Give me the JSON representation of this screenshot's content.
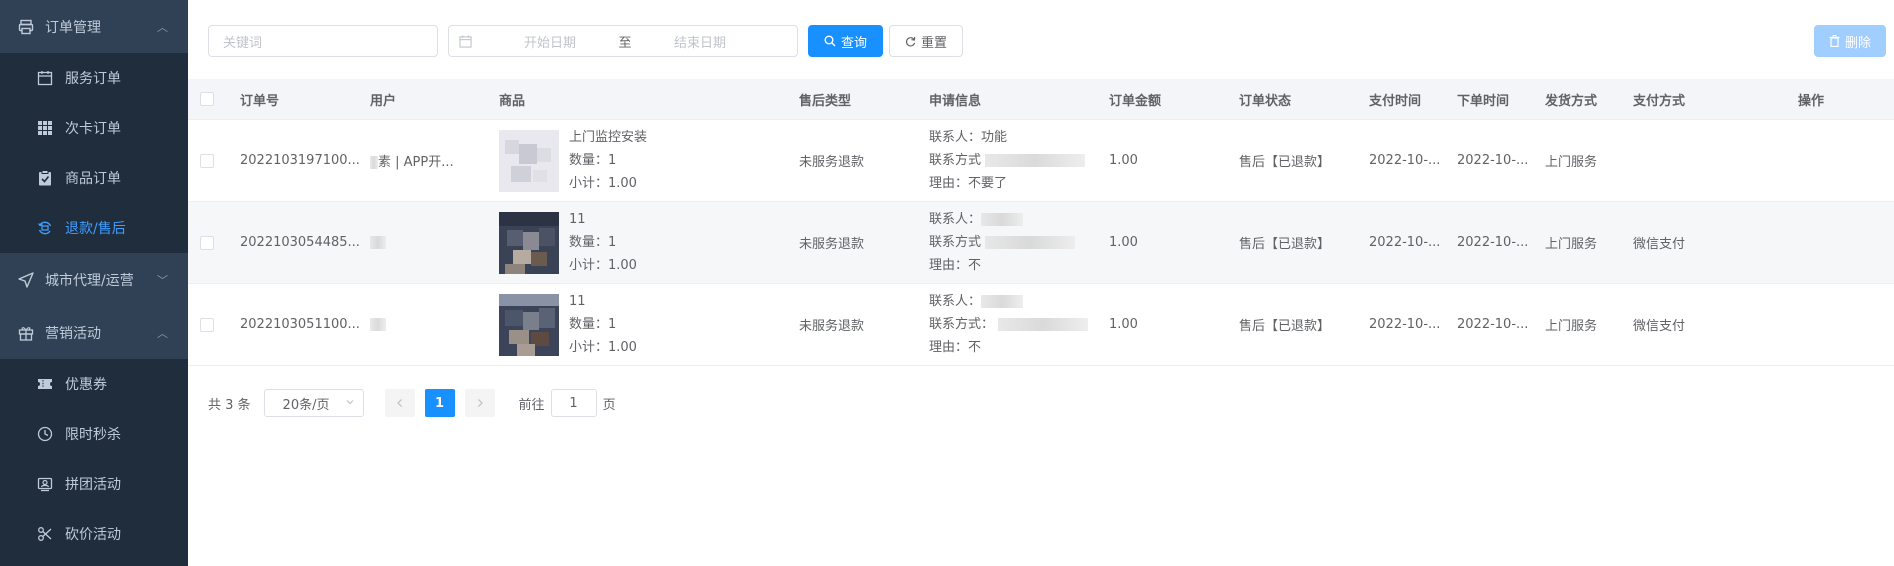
{
  "sidebar": {
    "groups": [
      {
        "label": "订单管理",
        "icon": "printer-icon",
        "expanded": true,
        "items": [
          {
            "label": "服务订单",
            "icon": "calendar-icon"
          },
          {
            "label": "次卡订单",
            "icon": "grid-icon"
          },
          {
            "label": "商品订单",
            "icon": "clipboard-icon"
          },
          {
            "label": "退款/售后",
            "icon": "refund-icon",
            "active": true
          }
        ]
      },
      {
        "label": "城市代理/运营",
        "icon": "navigation-icon",
        "expanded": false
      },
      {
        "label": "营销活动",
        "icon": "gift-icon",
        "expanded": true,
        "items": [
          {
            "label": "优惠券",
            "icon": "ticket-icon"
          },
          {
            "label": "限时秒杀",
            "icon": "clock-icon"
          },
          {
            "label": "拼团活动",
            "icon": "group-icon"
          },
          {
            "label": "砍价活动",
            "icon": "bargain-icon"
          }
        ]
      }
    ]
  },
  "filters": {
    "keyword_placeholder": "关键词",
    "date_start_placeholder": "开始日期",
    "date_separator": "至",
    "date_end_placeholder": "结束日期",
    "search_label": "查询",
    "reset_label": "重置",
    "delete_label": "删除"
  },
  "table": {
    "headers": [
      "订单号",
      "用户",
      "商品",
      "售后类型",
      "申请信息",
      "订单金额",
      "订单状态",
      "支付时间",
      "下单时间",
      "发货方式",
      "支付方式",
      "操作"
    ],
    "rows": [
      {
        "order_no": "2022103197100...",
        "user": "素 | APP开...",
        "goods_name": "上门监控安装",
        "goods_qty": "数量：1",
        "goods_subtotal": "小计：1.00",
        "after_type": "未服务退款",
        "contact": "联系人：功能",
        "contact_method": "联系方式",
        "reason": "理由：不要了",
        "amount": "1.00",
        "status": "售后【已退款】",
        "pay_time": "2022-10-...",
        "order_time": "2022-10-...",
        "ship": "上门服务",
        "pay_method": ""
      },
      {
        "order_no": "2022103054485...",
        "user": "",
        "goods_name": "11",
        "goods_qty": "数量：1",
        "goods_subtotal": "小计：1.00",
        "after_type": "未服务退款",
        "contact": "联系人：",
        "contact_method": "联系方式",
        "reason": "理由：不",
        "amount": "1.00",
        "status": "售后【已退款】",
        "pay_time": "2022-10-...",
        "order_time": "2022-10-...",
        "ship": "上门服务",
        "pay_method": "微信支付"
      },
      {
        "order_no": "2022103051100...",
        "user": "",
        "goods_name": "11",
        "goods_qty": "数量：1",
        "goods_subtotal": "小计：1.00",
        "after_type": "未服务退款",
        "contact": "联系人：",
        "contact_method": "联系方式：",
        "reason": "理由：不",
        "amount": "1.00",
        "status": "售后【已退款】",
        "pay_time": "2022-10-...",
        "order_time": "2022-10-...",
        "ship": "上门服务",
        "pay_method": "微信支付"
      }
    ]
  },
  "pagination": {
    "total": "共 3 条",
    "page_size": "20条/页",
    "current_page": "1",
    "goto_prefix": "前往",
    "goto_value": "1",
    "goto_suffix": "页"
  },
  "colors": {
    "sidebar_bg": "#1f2d3d",
    "sidebar_group_bg": "#304156",
    "accent": "#1890ff",
    "active_menu": "#409eff"
  }
}
